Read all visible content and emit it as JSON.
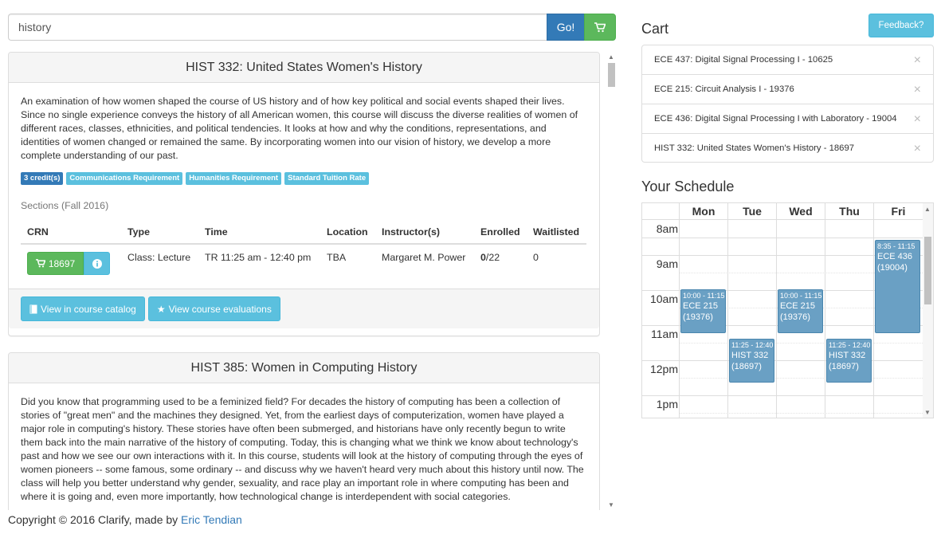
{
  "search": {
    "value": "history",
    "go_label": "Go!"
  },
  "courses": [
    {
      "title": "HIST 332: United States Women's History",
      "description": "An examination of how women shaped the course of US history and of how key political and social events shaped their lives. Since no single experience conveys the history of all American women, this course will discuss the diverse realities of women of different races, classes, ethnicities, and political tendencies. It looks at how and why the conditions, representations, and identities of women changed or remained the same. By incorporating women into our vision of history, we develop a more complete understanding of our past.",
      "labels": [
        "3 credit(s)",
        "Communications Requirement",
        "Humanities Requirement",
        "Standard Tuition Rate"
      ],
      "sections_title": "Sections (Fall 2016)",
      "columns": [
        "CRN",
        "Type",
        "Time",
        "Location",
        "Instructor(s)",
        "Enrolled",
        "Waitlisted"
      ],
      "section": {
        "crn": "18697",
        "type": "Class: Lecture",
        "time": "TR 11:25 am - 12:40 pm",
        "location": "TBA",
        "instructor": "Margaret M. Power",
        "enrolled": "0",
        "capacity": "/22",
        "waitlisted": "0"
      },
      "catalog_label": "View in course catalog",
      "evaluations_label": "View course evaluations"
    },
    {
      "title": "HIST 385: Women in Computing History",
      "description": "Did you know that programming used to be a feminized field? For decades the history of computing has been a collection of stories of \"great men\" and the machines they designed. Yet, from the earliest days of computerization, women have played a major role in computing's history. These stories have often been submerged, and historians have only recently begun to write them back into the main narrative of the history of computing. Today, this is changing what we think we know about technology's past and how we see our own interactions with it. In this course, students will look at the history of computing through the eyes of women pioneers -- some famous, some ordinary -- and discuss why we haven't heard very much about this history until now. The class will help you better understand why gender, sexuality, and race play an important role in where computing has been and where it is going and, even more importantly, how technological change is interdependent with social categories."
    }
  ],
  "footer": {
    "text": "Copyright © 2016 Clarify, made by ",
    "author": "Eric Tendian"
  },
  "cart": {
    "title": "Cart",
    "feedback_label": "Feedback?",
    "items": [
      "ECE 437: Digital Signal Processing I - 10625",
      "ECE 215: Circuit Analysis I - 19376",
      "ECE 436: Digital Signal Processing I with Laboratory - 19004",
      "HIST 332: United States Women's History - 18697"
    ],
    "remove_glyph": "×"
  },
  "schedule": {
    "title": "Your Schedule",
    "days": [
      "Mon",
      "Tue",
      "Wed",
      "Thu",
      "Fri"
    ],
    "times": [
      "8am",
      "9am",
      "10am",
      "11am",
      "12pm",
      "1pm"
    ],
    "events": [
      {
        "day": "Mon",
        "time": "10:00 - 11:15",
        "name": "ECE 215",
        "crn": "(19376)"
      },
      {
        "day": "Wed",
        "time": "10:00 - 11:15",
        "name": "ECE 215",
        "crn": "(19376)"
      },
      {
        "day": "Tue",
        "time": "11:25 - 12:40",
        "name": "HIST 332",
        "crn": "(18697)"
      },
      {
        "day": "Thu",
        "time": "11:25 - 12:40",
        "name": "HIST 332",
        "crn": "(18697)"
      },
      {
        "day": "Fri",
        "time": "8:35 - 11:15",
        "name": "ECE 436",
        "crn": "(19004)"
      }
    ]
  },
  "colors": {
    "primary": "#337ab7",
    "success": "#5cb85c",
    "info": "#5bc0de",
    "event": "#6aa0c4"
  }
}
